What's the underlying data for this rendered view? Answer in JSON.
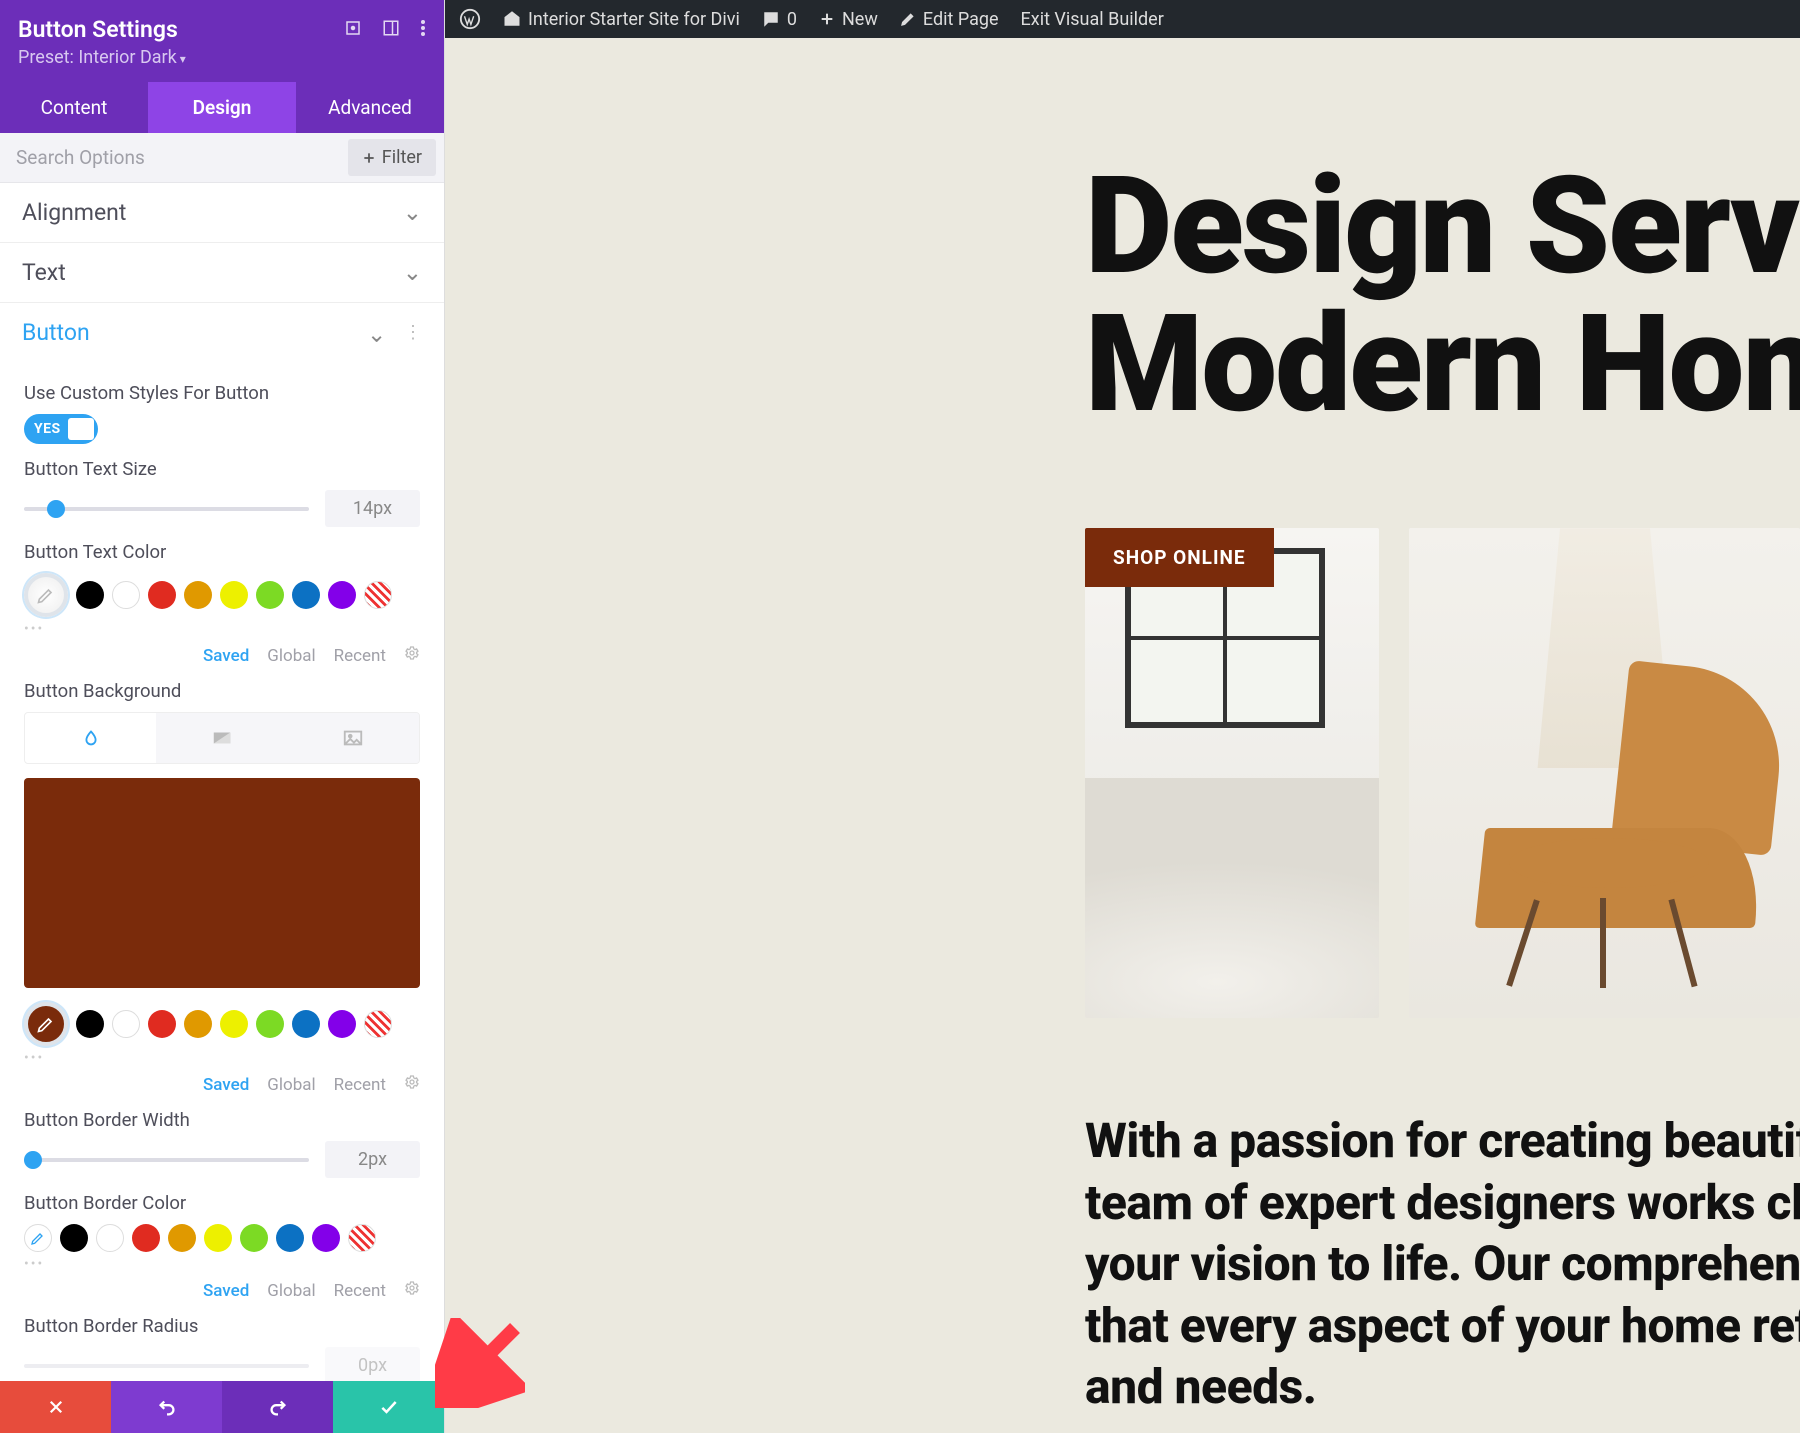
{
  "sidebar": {
    "title": "Button Settings",
    "preset": "Preset: Interior Dark",
    "tabs": {
      "content": "Content",
      "design": "Design",
      "advanced": "Advanced"
    },
    "search_placeholder": "Search Options",
    "filter": "Filter",
    "sections": {
      "alignment": "Alignment",
      "text": "Text",
      "button": "Button"
    },
    "button": {
      "use_custom_styles_label": "Use Custom Styles For Button",
      "toggle_yes": "YES",
      "text_size_label": "Button Text Size",
      "text_size_value": "14px",
      "text_color_label": "Button Text Color",
      "background_label": "Button Background",
      "border_width_label": "Button Border Width",
      "border_width_value": "2px",
      "border_color_label": "Button Border Color",
      "border_radius_label": "Button Border Radius",
      "border_radius_value": "0px"
    },
    "palette": {
      "black": "#000000",
      "white": "#ffffff",
      "red": "#e02b20",
      "orange": "#e09900",
      "yellow": "#edf000",
      "green": "#7cda24",
      "blue": "#0c71c3",
      "purple": "#8300e9"
    },
    "bg_color": "#7a2b0b",
    "links": {
      "saved": "Saved",
      "global": "Global",
      "recent": "Recent"
    }
  },
  "wp": {
    "site_name": "Interior Starter Site for Divi",
    "comments": "0",
    "new": "New",
    "edit": "Edit Page",
    "exit": "Exit Visual Builder"
  },
  "page": {
    "hero_line1": "Design Services",
    "hero_line2": "Modern Homes",
    "shop_button": "SHOP ONLINE",
    "body_l1": "With a passion for creating beautiful, functional",
    "body_l2": "team of expert designers works closely with yo",
    "body_l3": "your vision to life. Our comprehensive approac",
    "body_l4": "that every aspect of your home reflects your un",
    "body_l5": "and needs."
  }
}
